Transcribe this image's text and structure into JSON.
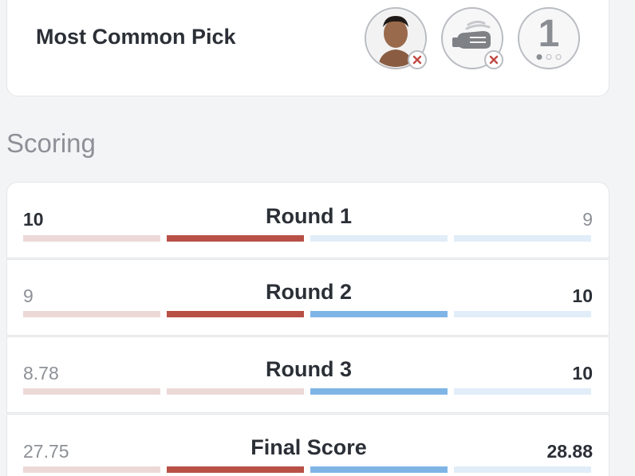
{
  "most_common_pick": {
    "title": "Most Common Pick",
    "icons": [
      "fighter-avatar-icon",
      "glove-punch-icon",
      "round-one-icon"
    ],
    "round_number": "1"
  },
  "scoring": {
    "section_title": "Scoring",
    "colors": {
      "red_strong": "#b85046",
      "red_light": "#ecd9d7",
      "blue_strong": "#7fb5e6",
      "blue_light": "#e1edf8"
    },
    "rows": [
      {
        "label": "Round 1",
        "left_score": "10",
        "right_score": "9",
        "left_bold": true,
        "right_bold": false,
        "bars": [
          "red_light",
          "red_strong",
          "blue_light",
          "blue_light"
        ]
      },
      {
        "label": "Round 2",
        "left_score": "9",
        "right_score": "10",
        "left_bold": false,
        "right_bold": true,
        "bars": [
          "red_light",
          "red_strong",
          "blue_strong",
          "blue_light"
        ]
      },
      {
        "label": "Round 3",
        "left_score": "8.78",
        "right_score": "10",
        "left_bold": false,
        "right_bold": true,
        "bars": [
          "red_light",
          "red_light",
          "blue_strong",
          "blue_light"
        ]
      },
      {
        "label": "Final Score",
        "left_score": "27.75",
        "right_score": "28.88",
        "left_bold": false,
        "right_bold": true,
        "bars": [
          "red_light",
          "red_strong",
          "blue_strong",
          "blue_light"
        ]
      }
    ]
  }
}
